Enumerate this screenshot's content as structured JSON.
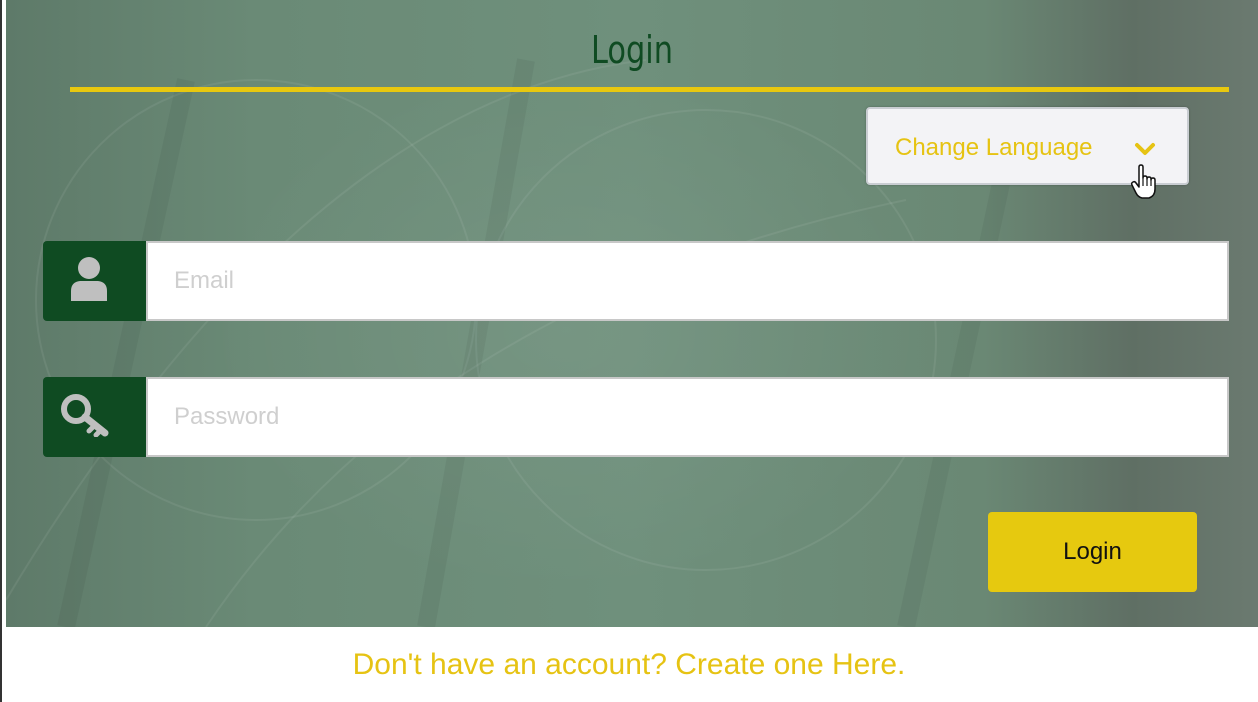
{
  "page": {
    "title": "Login"
  },
  "language": {
    "button_label": "Change Language"
  },
  "form": {
    "email_placeholder": "Email",
    "password_placeholder": "Password",
    "login_label": "Login"
  },
  "footer": {
    "signup_text": "Don't have an account? Create one Here."
  },
  "icons": {
    "email": "user-icon",
    "password": "key-icon",
    "language": "chevron-down-icon",
    "cursor": "hand-pointer-icon"
  },
  "colors": {
    "primary_green": "#0f4b22",
    "accent_yellow": "#e6c90f",
    "background_green": "#6f907c"
  }
}
